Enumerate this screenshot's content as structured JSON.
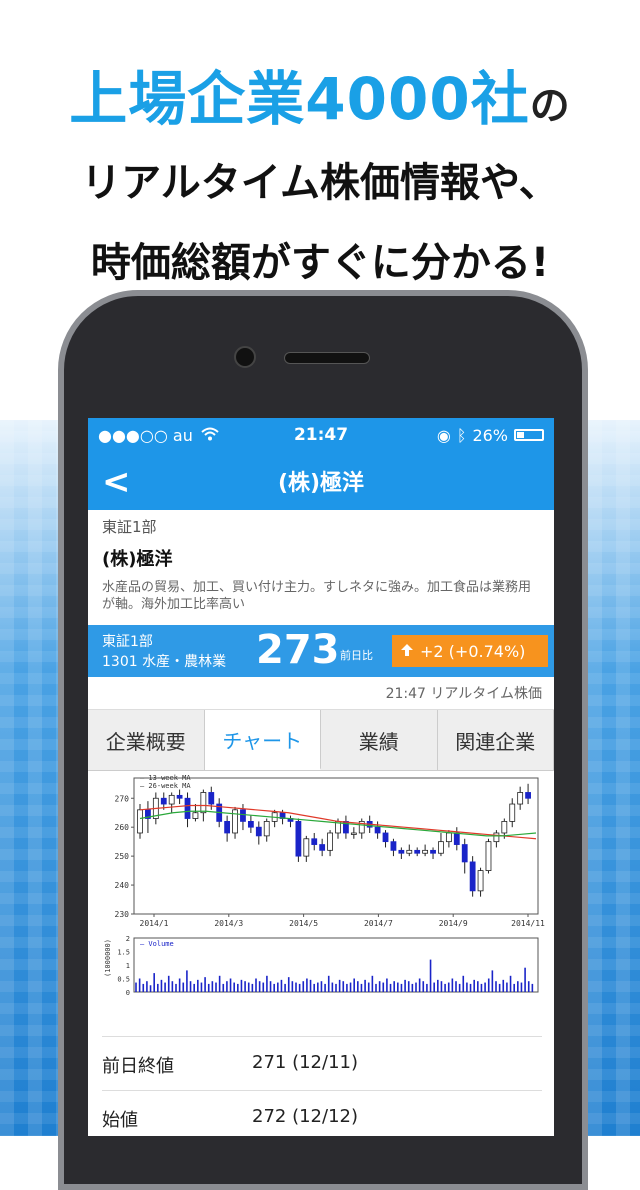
{
  "headline": {
    "line1_main": "上場企業4000社",
    "line1_suffix": "の",
    "line2": "リアルタイム株価情報や、",
    "line3": "時価総額がすぐに分かる!"
  },
  "status_bar": {
    "carrier": "●●●○○ au",
    "time": "21:47",
    "battery": "26%"
  },
  "nav": {
    "title": "(株)極洋"
  },
  "company": {
    "market": "東証1部",
    "name": "(株)極洋",
    "description": "水産品の貿易、加工、買い付け主力。すしネタに強み。加工食品は業務用が軸。海外加工比率高い"
  },
  "quote": {
    "market": "東証1部",
    "code_sector": "1301 水産・農林業",
    "price": "273",
    "prev_label": "前日比",
    "change": "+2 (+0.74%)",
    "realtime_label": "21:47 リアルタイム株価"
  },
  "tabs": [
    "企業概要",
    "チャート",
    "業績",
    "関連企業"
  ],
  "colors": {
    "primary": "#1e96e8",
    "accent": "#f7931e"
  },
  "chart_data": {
    "type": "candlestick",
    "legend": [
      "13-week MA",
      "26-week MA"
    ],
    "xlabels": [
      "2014/1",
      "2014/3",
      "2014/5",
      "2014/7",
      "2014/9",
      "2014/11"
    ],
    "ylim": [
      230,
      277
    ],
    "yticks": [
      230,
      240,
      250,
      260,
      270
    ],
    "candles": [
      [
        258,
        266,
        256,
        268
      ],
      [
        266,
        263,
        258,
        269
      ],
      [
        263,
        270,
        261,
        272
      ],
      [
        270,
        268,
        266,
        272
      ],
      [
        268,
        271,
        265,
        272
      ],
      [
        271,
        270,
        268,
        273
      ],
      [
        270,
        263,
        260,
        272
      ],
      [
        263,
        265,
        262,
        268
      ],
      [
        265,
        272,
        262,
        273
      ],
      [
        272,
        268,
        266,
        274
      ],
      [
        268,
        262,
        260,
        270
      ],
      [
        262,
        258,
        255,
        264
      ],
      [
        258,
        266,
        256,
        267
      ],
      [
        266,
        262,
        259,
        268
      ],
      [
        262,
        260,
        258,
        264
      ],
      [
        260,
        257,
        254,
        262
      ],
      [
        257,
        262,
        255,
        263
      ],
      [
        262,
        265,
        260,
        266
      ],
      [
        265,
        263,
        261,
        266
      ],
      [
        263,
        262,
        260,
        264
      ],
      [
        262,
        250,
        248,
        263
      ],
      [
        250,
        256,
        248,
        257
      ],
      [
        256,
        254,
        252,
        258
      ],
      [
        254,
        252,
        250,
        256
      ],
      [
        252,
        258,
        250,
        259
      ],
      [
        258,
        262,
        256,
        263
      ],
      [
        262,
        258,
        256,
        264
      ],
      [
        258,
        258,
        256,
        260
      ],
      [
        258,
        262,
        256,
        263
      ],
      [
        262,
        260,
        258,
        264
      ],
      [
        260,
        258,
        256,
        262
      ],
      [
        258,
        255,
        253,
        259
      ],
      [
        255,
        252,
        250,
        256
      ],
      [
        252,
        251,
        249,
        253
      ],
      [
        251,
        252,
        250,
        254
      ],
      [
        252,
        251,
        250,
        253
      ],
      [
        251,
        252,
        250,
        254
      ],
      [
        252,
        251,
        249,
        253
      ],
      [
        251,
        255,
        250,
        258
      ],
      [
        255,
        258,
        253,
        259
      ],
      [
        258,
        254,
        252,
        260
      ],
      [
        254,
        248,
        244,
        256
      ],
      [
        248,
        238,
        236,
        250
      ],
      [
        238,
        245,
        236,
        246
      ],
      [
        245,
        255,
        244,
        256
      ],
      [
        255,
        258,
        253,
        259
      ],
      [
        258,
        262,
        256,
        263
      ],
      [
        262,
        268,
        260,
        270
      ],
      [
        268,
        272,
        266,
        274
      ],
      [
        272,
        270,
        268,
        275
      ]
    ],
    "ma13": [
      266,
      266.5,
      267,
      267.5,
      267.5,
      267,
      266.5,
      266,
      265.5,
      265,
      264,
      263,
      262,
      261.5,
      261,
      260.5,
      260,
      259.5,
      259,
      258.5,
      258,
      257.5,
      257,
      256.5,
      256
    ],
    "ma26": [
      263,
      264,
      265,
      265.5,
      265.5,
      265,
      264.5,
      264,
      263.5,
      263,
      262.5,
      262,
      261.5,
      261,
      260.5,
      260,
      259.5,
      259,
      258.5,
      258,
      257.5,
      257,
      257,
      257.5,
      258
    ],
    "volume": {
      "label": "Volume",
      "ylabel": "(1000000)",
      "yticks": [
        "2",
        "1.5",
        "1",
        "0.5",
        "0"
      ],
      "values": [
        0.35,
        0.5,
        0.3,
        0.4,
        0.25,
        0.7,
        0.3,
        0.45,
        0.35,
        0.6,
        0.4,
        0.3,
        0.5,
        0.35,
        0.8,
        0.4,
        0.3,
        0.45,
        0.35,
        0.55,
        0.3,
        0.4,
        0.35,
        0.6,
        0.3,
        0.4,
        0.5,
        0.35,
        0.3,
        0.45,
        0.4,
        0.35,
        0.3,
        0.5,
        0.4,
        0.35,
        0.6,
        0.4,
        0.3,
        0.35,
        0.45,
        0.3,
        0.55,
        0.4,
        0.35,
        0.3,
        0.4,
        0.5,
        0.45,
        0.3,
        0.35,
        0.4,
        0.3,
        0.6,
        0.35,
        0.3,
        0.45,
        0.4,
        0.3,
        0.35,
        0.5,
        0.4,
        0.3,
        0.45,
        0.35,
        0.6,
        0.3,
        0.4,
        0.35,
        0.5,
        0.3,
        0.4,
        0.35,
        0.3,
        0.45,
        0.4,
        0.3,
        0.35,
        0.5,
        0.4,
        0.3,
        1.2,
        0.35,
        0.45,
        0.4,
        0.3,
        0.35,
        0.5,
        0.4,
        0.3,
        0.6,
        0.35,
        0.3,
        0.45,
        0.4,
        0.3,
        0.35,
        0.5,
        0.8,
        0.4,
        0.3,
        0.45,
        0.35,
        0.6,
        0.3,
        0.4,
        0.35,
        0.9,
        0.4,
        0.3
      ]
    }
  },
  "details": [
    {
      "label": "前日終値",
      "value": "271 (12/11)"
    },
    {
      "label": "始値",
      "value": "272 (12/12)"
    }
  ]
}
